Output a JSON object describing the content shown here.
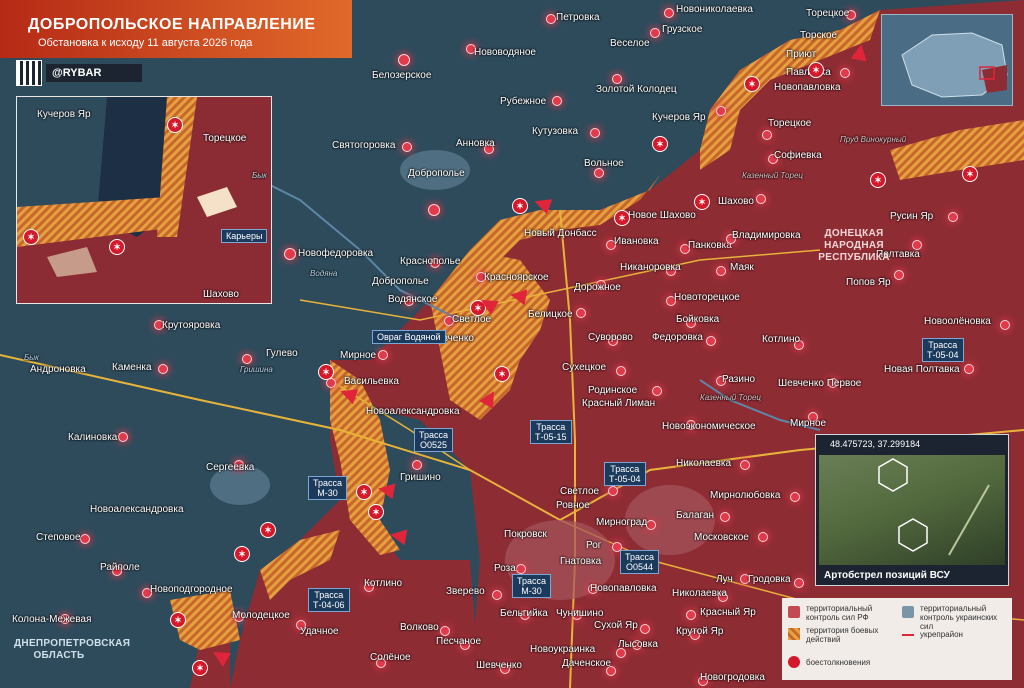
{
  "header": {
    "title": "ДОБРОПОЛЬСКОЕ НАПРАВЛЕНИЕ",
    "subtitle": "Обстановка к исходу 11 августа 2026 года",
    "brand": "@RYBAR"
  },
  "colors": {
    "russian_control": "#8e2c34",
    "ukrainian_control": "#2e4b5c",
    "combat_zone": "#e1963a",
    "clash": "#d3192a",
    "fortified_line": "#e0253a"
  },
  "map": {
    "cities": [
      "Новониколаевка",
      "Торецкое",
      "Торское",
      "Приют",
      "Павловка",
      "Новопавловка",
      "Петровка",
      "Грузское",
      "Веселое",
      "Нововодяное",
      "Белозерское",
      "Рубежное",
      "Золотой Колодец",
      "Кучеров Яр",
      "Кутузовка",
      "Торецкое",
      "Софиевка",
      "Святогоровка",
      "Анновка",
      "Доброполье",
      "Вольное",
      "Шахово",
      "Новое Шахово",
      "Новый Донбасс",
      "Ивановка",
      "Панковка",
      "Владимировка",
      "Русин Яр",
      "Полтавка",
      "Новофедоровка",
      "Краснополье",
      "Красноярское",
      "Никаноровка",
      "Маяк",
      "Попов Яр",
      "Доброполье",
      "Водянское",
      "Дорожное",
      "Белицкое",
      "Светлое",
      "Шевченко",
      "Новоторецкое",
      "Бойковка",
      "Новоолёновка",
      "Крутояровка",
      "Гулево",
      "Мирное",
      "Суворово",
      "Федоровка",
      "Котлино",
      "Андроновка",
      "Каменка",
      "Васильевка",
      "Сухецкое",
      "Родинское",
      "Разино",
      "Шевченко Первое",
      "Новая Полтавка",
      "Новоалександровка",
      "Красный Лиман",
      "Мирное",
      "Калиновка",
      "Новоэкономическое",
      "Гришино",
      "Сергеевка",
      "Николаевка",
      "Светлое",
      "Новоалександровка",
      "Ровное",
      "Мирнoград",
      "Балаган",
      "Мирнолюбовка",
      "Степовое",
      "Покровск",
      "Рог",
      "Московское",
      "Райполе",
      "Роза",
      "Гнатовка",
      "Луч",
      "Гродовка",
      "Новоподгородное",
      "Котлино",
      "Зверево",
      "Новопавловка",
      "Николаевка",
      "Красный Яр",
      "Колона-Межевая",
      "Молодецкое",
      "Удачное",
      "Бельгийка",
      "Чунишино",
      "Сухой Яр",
      "Крутой Яр",
      "Волково",
      "Песчаное",
      "Новоукраинка",
      "Лысовка",
      "Солёное",
      "Шевченко",
      "Даченское",
      "Новогродовка"
    ],
    "rivers": [
      "Бык",
      "Водяна",
      "Казенный Торец",
      "Гришина",
      "Бык",
      "Казенный Торец",
      "Пруд Винокурный"
    ],
    "regions": [
      "ДОНЕЦКАЯ НАРОДНАЯ РЕСПУБЛИКА",
      "ДНЕПРОПЕТРОВСКАЯ ОБЛАСТЬ"
    ],
    "highways": [
      {
        "label": "Трасса",
        "code": "О0525"
      },
      {
        "label": "Трасса",
        "code": "Т-05-15"
      },
      {
        "label": "Трасса",
        "code": "М-30"
      },
      {
        "label": "Трасса",
        "code": "Т-05-04"
      },
      {
        "label": "Трасса",
        "code": "О0544"
      },
      {
        "label": "Трасса",
        "code": "М-30"
      },
      {
        "label": "Трасса",
        "code": "Т-04-06"
      },
      {
        "label": "Трасса",
        "code": "Т-05-04"
      }
    ],
    "water_feature": "Овраг Водяной"
  },
  "inset_left": {
    "labels": [
      "Кучеров Яр",
      "Торецкое",
      "Карьеры",
      "Шахово"
    ]
  },
  "photo": {
    "coords": "48.475723, 37.299184",
    "caption": "Артобстрел позиций ВСУ"
  },
  "legend": {
    "ru": "территориальный контроль сил РФ",
    "ua": "территориальный контроль украинских сил",
    "combat": "территория боевых действий",
    "fort": "укрепрайон",
    "clash": "боестолкновения"
  }
}
